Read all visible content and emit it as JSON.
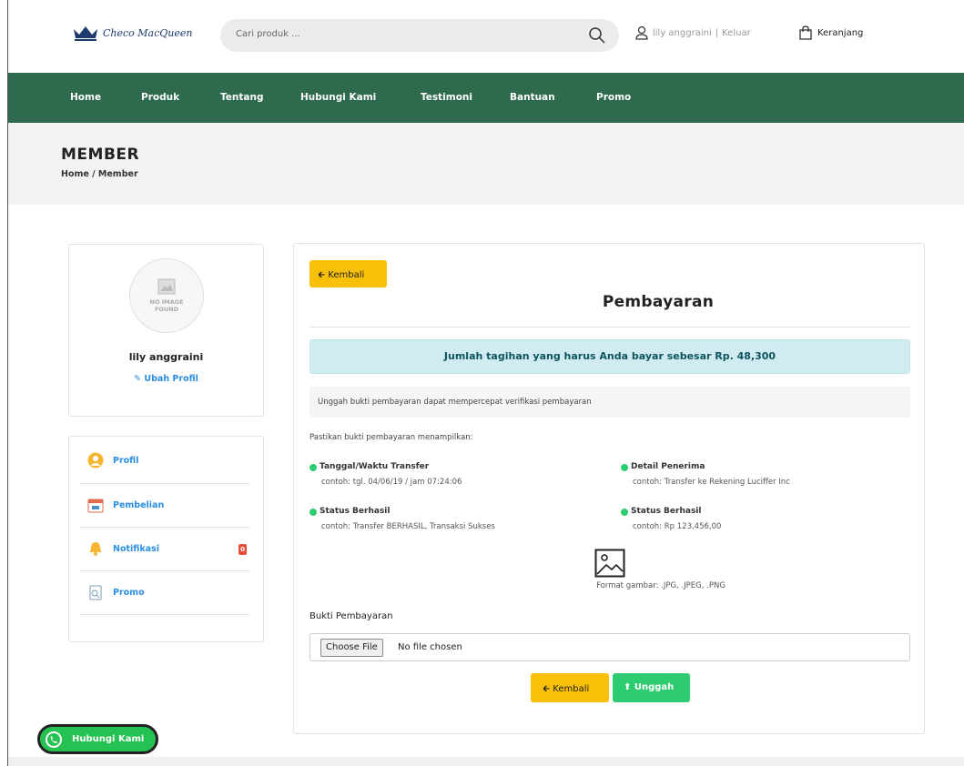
{
  "header": {
    "logo_text": "Checo MacQueen",
    "search_placeholder": "Cari produk ...",
    "user_name": "lily anggraini",
    "logout": "Keluar",
    "cart": "Keranjang"
  },
  "nav": [
    "Home",
    "Produk",
    "Tentang",
    "Hubungi Kami",
    "Testimoni",
    "Bantuan",
    "Promo"
  ],
  "page": {
    "title": "MEMBER",
    "breadcrumb": "Home / Member"
  },
  "profile": {
    "no_image_line1": "NO IMAGE",
    "no_image_line2": "FOUND",
    "name": "lily anggraini",
    "edit": "Ubah Profil"
  },
  "menu": [
    {
      "label": "Profil"
    },
    {
      "label": "Pembelian"
    },
    {
      "label": "Notifikasi",
      "badge": "0"
    },
    {
      "label": "Promo"
    }
  ],
  "payment": {
    "back_top": "Kembali",
    "title": "Pembayaran",
    "alert": "Jumlah tagihan yang harus Anda bayar sebesar Rp. 48,300",
    "note": "Unggah bukti pembayaran dapat mempercepat verifikasi pembayaran",
    "hint": "Pastikan bukti pembayaran menampilkan:",
    "requirements": [
      {
        "title": "Tanggal/Waktu Transfer",
        "sub": "contoh: tgl. 04/06/19 / jam 07:24:06"
      },
      {
        "title": "Detail Penerima",
        "sub": "contoh: Transfer ke Rekening Luciffer Inc"
      },
      {
        "title": "Status Berhasil",
        "sub": "contoh: Transfer BERHASIL, Transaksi Sukses"
      },
      {
        "title": "Status Berhasil",
        "sub": "contoh: Rp 123.456,00"
      }
    ],
    "format": "Format gambar: .JPG, .JPEG, .PNG",
    "file_label": "Bukti Pembayaran",
    "file_button": "Choose File",
    "file_status": "No file chosen",
    "back_bottom": "Kembali",
    "upload": "Unggah"
  },
  "whatsapp": "Hubungi Kami",
  "colors": {
    "nav_bg": "#2e6a4e",
    "accent_yellow": "#f9c00a",
    "accent_green": "#2ecc71",
    "link_blue": "#2b8ee0",
    "alert_bg": "#d1ecf1"
  }
}
